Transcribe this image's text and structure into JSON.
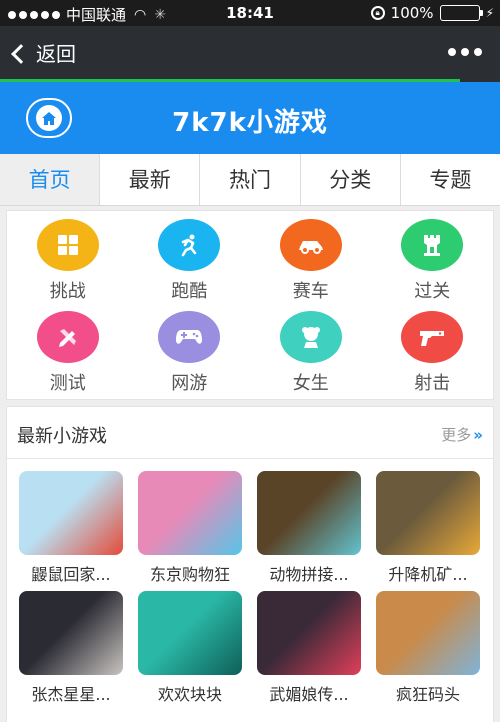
{
  "status_bar": {
    "carrier": "中国联通",
    "time": "18:41",
    "battery": "100%"
  },
  "nav": {
    "back_label": "返回",
    "page_load_progress": 0.92
  },
  "header": {
    "title": "7k7k小游戏"
  },
  "tabs": [
    {
      "label": "首页",
      "active": true
    },
    {
      "label": "最新",
      "active": false
    },
    {
      "label": "热门",
      "active": false
    },
    {
      "label": "分类",
      "active": false
    },
    {
      "label": "专题",
      "active": false
    }
  ],
  "categories": [
    {
      "label": "挑战",
      "icon": "grid-icon",
      "color": "#f5b416"
    },
    {
      "label": "跑酷",
      "icon": "runner-icon",
      "color": "#1ab4f0"
    },
    {
      "label": "赛车",
      "icon": "car-icon",
      "color": "#f2681f"
    },
    {
      "label": "过关",
      "icon": "castle-icon",
      "color": "#2ecc71"
    },
    {
      "label": "测试",
      "icon": "pencil-icon",
      "color": "#f24e8a"
    },
    {
      "label": "网游",
      "icon": "gamepad-icon",
      "color": "#9a8ee0"
    },
    {
      "label": "女生",
      "icon": "girl-icon",
      "color": "#3fd0c0"
    },
    {
      "label": "射击",
      "icon": "gun-icon",
      "color": "#f04b45"
    }
  ],
  "new_games": {
    "title": "最新小游戏",
    "more_label": "更多",
    "items": [
      {
        "name": "鼹鼠回家...",
        "colors": [
          "#b9e0f2",
          "#e34b3a"
        ]
      },
      {
        "name": "东京购物狂",
        "colors": [
          "#e88ab8",
          "#55c6e8"
        ]
      },
      {
        "name": "动物拼接...",
        "colors": [
          "#5a4428",
          "#62c4d0"
        ]
      },
      {
        "name": "升降机矿...",
        "colors": [
          "#6b5a3c",
          "#e8a93a"
        ]
      },
      {
        "name": "张杰星星...",
        "colors": [
          "#2b2b33",
          "#c9c4c0"
        ]
      },
      {
        "name": "欢欢块块",
        "colors": [
          "#2ab7a5",
          "#0f5f59"
        ]
      },
      {
        "name": "武媚娘传...",
        "colors": [
          "#3a2a38",
          "#e23f5a"
        ]
      },
      {
        "name": "疯狂码头",
        "colors": [
          "#c98a4a",
          "#7fb4d8"
        ]
      }
    ]
  }
}
